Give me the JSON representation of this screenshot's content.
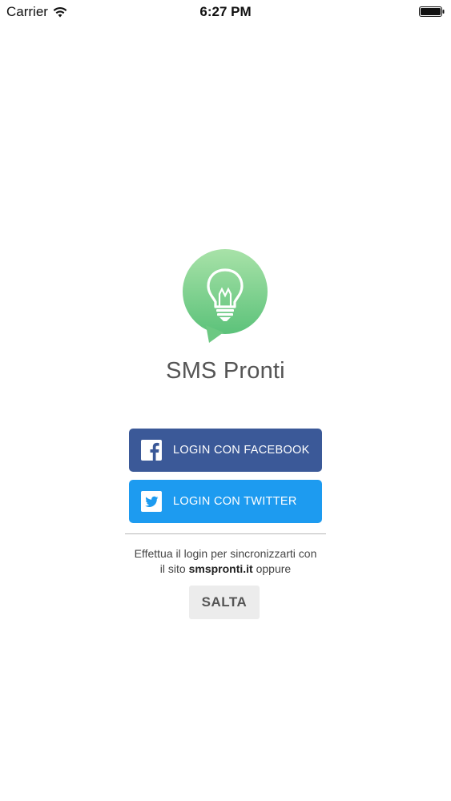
{
  "status_bar": {
    "carrier": "Carrier",
    "time": "6:27 PM",
    "wifi_icon": "wifi-icon",
    "battery_icon": "battery-icon"
  },
  "app": {
    "title": "SMS Pronti",
    "logo_icon": "lightbulb-speech-bubble-icon",
    "logo_color_top": "#a8e2a8",
    "logo_color_bottom": "#5cc27a"
  },
  "buttons": {
    "facebook": {
      "label": "LOGIN CON FACEBOOK",
      "color": "#3b5998",
      "icon": "facebook-icon"
    },
    "twitter": {
      "label": "LOGIN CON TWITTER",
      "color": "#1d9bf0",
      "icon": "twitter-icon"
    },
    "skip": {
      "label": "SALTA"
    }
  },
  "info": {
    "line1": "Effettua il login per sincronizzarti con",
    "line2_prefix": "il sito ",
    "line2_site": "smspronti.it",
    "line2_suffix": " oppure"
  }
}
